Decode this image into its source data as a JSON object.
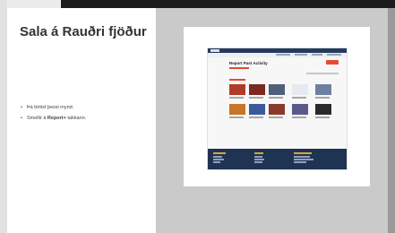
{
  "slide": {
    "title": "Sala á Rauðri fjöður",
    "bullets": [
      {
        "text": "Þá birtist þessi mynd."
      },
      {
        "before": "Smellir á ",
        "bold": "Report+",
        "after": " takkann."
      }
    ]
  },
  "embedded_screenshot": {
    "page_title": "Report Past Activity"
  },
  "colors": {
    "nav": "#243a5e",
    "accent": "#e64a2e",
    "footer": "#1f3352"
  }
}
